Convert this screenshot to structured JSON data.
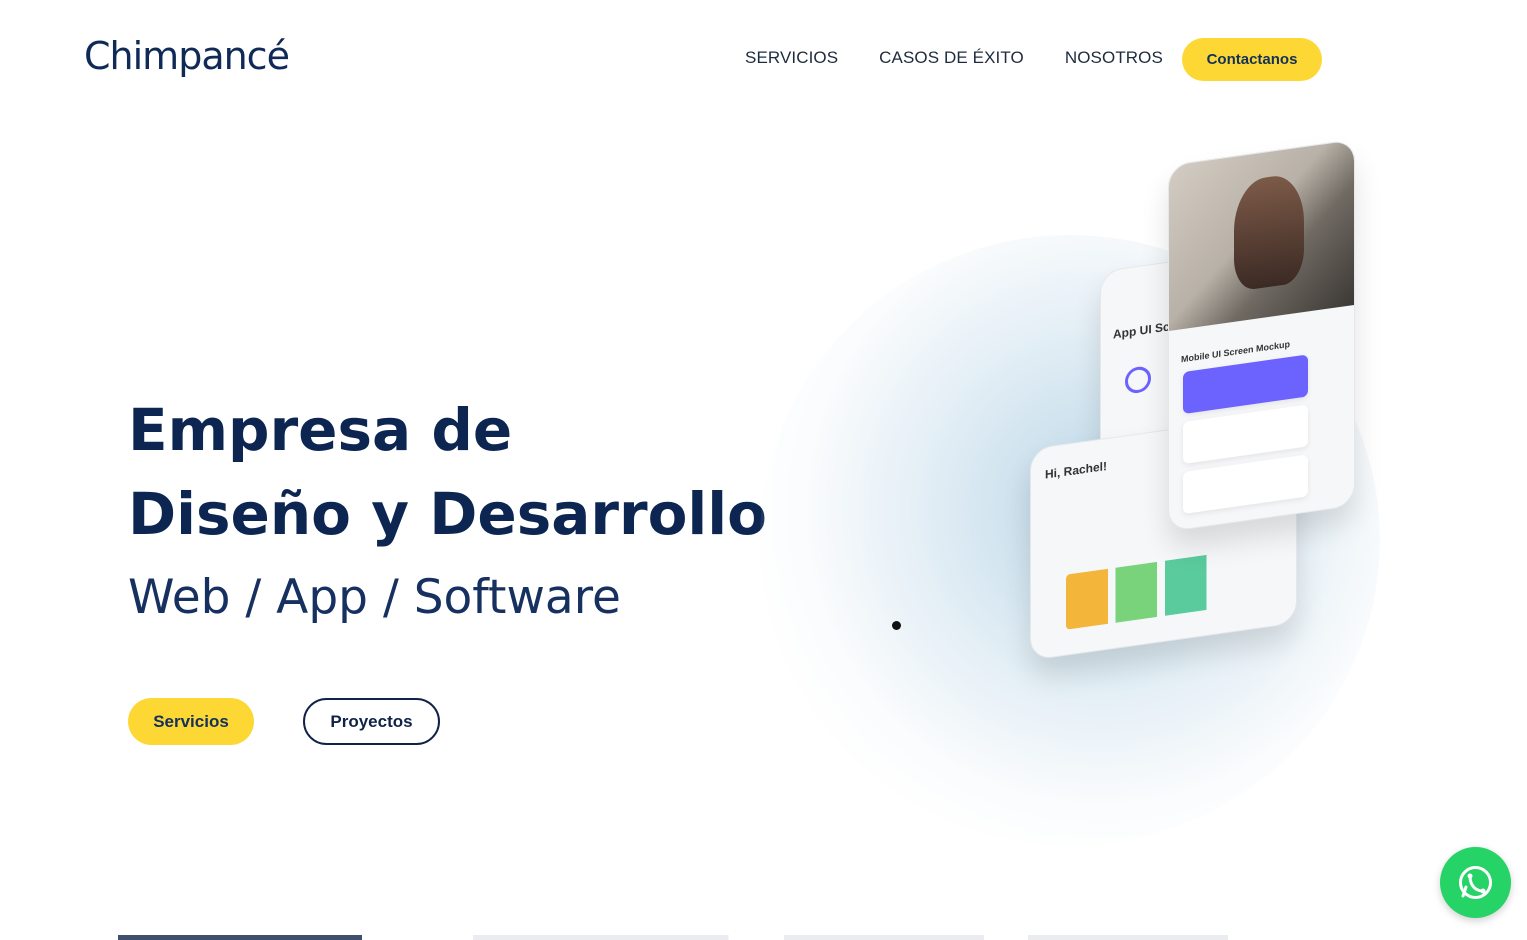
{
  "header": {
    "logo_text": "Chimpancé",
    "nav": [
      "SERVICIOS",
      "CASOS DE ÉXITO",
      "NOSOTROS"
    ],
    "cta_label": "Contactanos"
  },
  "hero": {
    "title_line1": "Empresa de",
    "title_line2": "Diseño y Desarrollo",
    "subtitle": "Web / App / Software",
    "primary_button": "Servicios",
    "secondary_button": "Proyectos"
  },
  "mockup": {
    "back_screen_title": "App UI Screens",
    "left_screen_greeting": "Hi, Rachel!",
    "right_screen_title": "Mobile UI Screen Mockup"
  },
  "colors": {
    "brand_navy": "#0f2347",
    "accent_yellow": "#fdd835",
    "whatsapp_green": "#25d366"
  },
  "icons": {
    "whatsapp": "whatsapp-icon"
  }
}
